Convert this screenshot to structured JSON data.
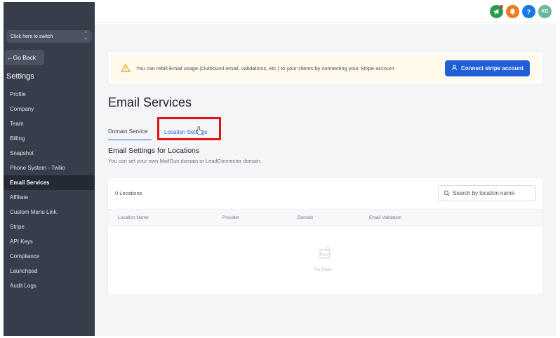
{
  "sidebar": {
    "switcher_label": "Click here to switch",
    "go_back": "Go Back",
    "section_title": "Settings",
    "items": [
      {
        "label": "Profile"
      },
      {
        "label": "Company"
      },
      {
        "label": "Team"
      },
      {
        "label": "Billing"
      },
      {
        "label": "Snapshot"
      },
      {
        "label": "Phone System - Twilio"
      },
      {
        "label": "Email Services",
        "active": true
      },
      {
        "label": "Affiliate"
      },
      {
        "label": "Custom Menu Link"
      },
      {
        "label": "Stripe"
      },
      {
        "label": "API Keys"
      },
      {
        "label": "Compliance"
      },
      {
        "label": "Launchpad"
      },
      {
        "label": "Audit Logs"
      }
    ]
  },
  "topbar": {
    "icons": [
      "megaphone-icon",
      "bell-icon",
      "help-icon"
    ],
    "help_glyph": "?",
    "avatar_initials": "KC"
  },
  "banner": {
    "text": "You can rebill Email usage (Outbound email, validations, etc.) to your clients by connecting your Stripe account",
    "button_label": "Connect stripe account"
  },
  "page": {
    "title": "Email Services",
    "tabs": [
      {
        "label": "Domain Service",
        "active": true
      },
      {
        "label": "Location Settings",
        "active": false
      }
    ],
    "section_title": "Email Settings for Locations",
    "section_subtitle": "You can set your own MailGun domain or LeadConnector domain."
  },
  "table": {
    "count_label": "0 Locations",
    "search_placeholder": "Search by location name",
    "columns": [
      "Location Name",
      "Provider",
      "Domain",
      "Email Validation"
    ],
    "empty_text": "No Data"
  },
  "colors": {
    "sidebar_bg": "#363d4b",
    "accent": "#1f5fd7",
    "highlight_box": "#e31414"
  }
}
